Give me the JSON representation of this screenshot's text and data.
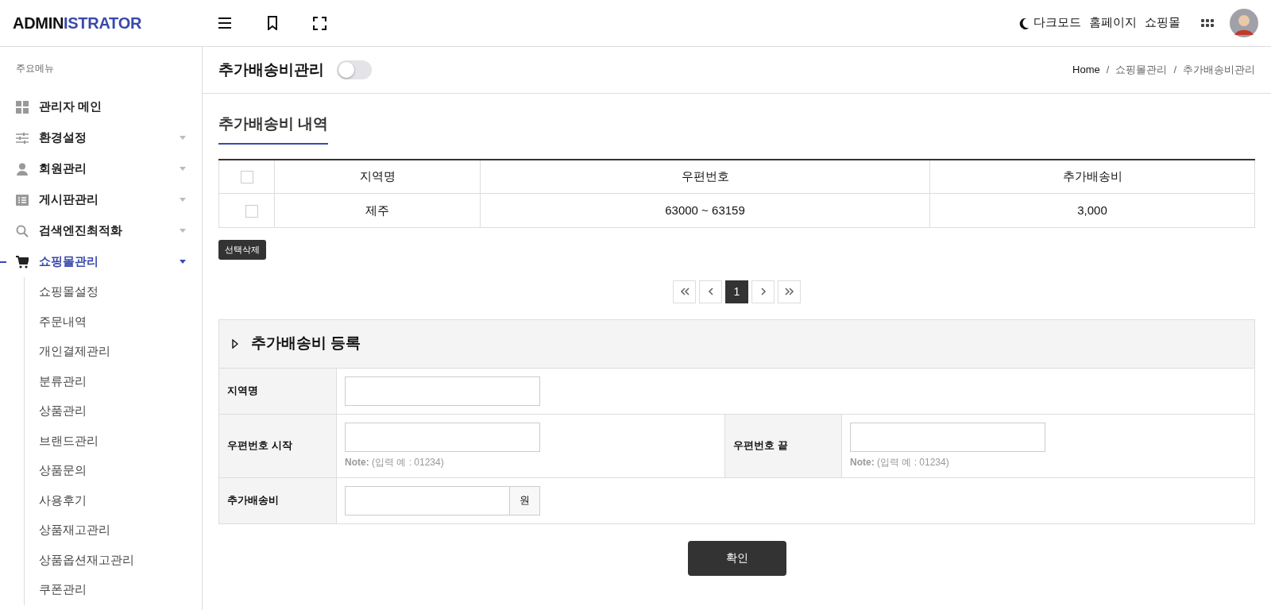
{
  "brand": {
    "part_1": "ADMIN",
    "part_2": "ISTRATOR"
  },
  "header_links": [
    {
      "label": "다크모드",
      "kind": "darkmode"
    },
    {
      "label": "홈페이지",
      "kind": "link"
    },
    {
      "label": "쇼핑몰",
      "kind": "link"
    }
  ],
  "sidebar": {
    "heading": "주요메뉴",
    "items": [
      {
        "label": "관리자 메인",
        "kind": "grid",
        "expandable": false,
        "selected": false
      },
      {
        "label": "환경설정",
        "kind": "sliders",
        "expandable": true,
        "selected": false
      },
      {
        "label": "회원관리",
        "kind": "person",
        "expandable": true,
        "selected": false
      },
      {
        "label": "게시판관리",
        "kind": "list",
        "expandable": true,
        "selected": false
      },
      {
        "label": "검색엔진최적화",
        "kind": "search",
        "expandable": true,
        "selected": false
      },
      {
        "label": "쇼핑몰관리",
        "kind": "cart",
        "expandable": true,
        "selected": true,
        "children": [
          {
            "label": "쇼핑몰설정"
          },
          {
            "label": "주문내역"
          },
          {
            "label": "개인결제관리"
          },
          {
            "label": "분류관리"
          },
          {
            "label": "상품관리"
          },
          {
            "label": "브랜드관리"
          },
          {
            "label": "상품문의"
          },
          {
            "label": "사용후기"
          },
          {
            "label": "상품재고관리"
          },
          {
            "label": "상품옵션재고관리"
          },
          {
            "label": "쿠폰관리"
          }
        ]
      }
    ]
  },
  "page": {
    "title": "추가배송비관리",
    "toggle": {
      "on": false
    },
    "breadcrumb": [
      {
        "label": "Home"
      },
      {
        "separator": "/",
        "label": "쇼핑몰관리"
      },
      {
        "separator": "/",
        "label": "추가배송비관리"
      }
    ]
  },
  "list_section": {
    "title": "추가배송비 내역",
    "table": {
      "select_all": {
        "checked": false
      },
      "columns": [
        "지역명",
        "우편번호",
        "추가배송비"
      ],
      "rows": [
        {
          "checked": false,
          "cells": [
            "제주",
            "63000 ~ 63159",
            "3,000"
          ]
        }
      ]
    },
    "delete_button": "선택삭제",
    "pagination": [
      {
        "kind": "first",
        "selected": false
      },
      {
        "kind": "prev",
        "selected": false
      },
      {
        "label": "1",
        "kind": "page",
        "selected": true
      },
      {
        "kind": "next",
        "selected": false
      },
      {
        "kind": "last",
        "selected": false
      }
    ]
  },
  "form": {
    "title": "추가배송비 등록",
    "rows": [
      {
        "fields": [
          {
            "label": "지역명"
          }
        ]
      },
      {
        "fields": [
          {
            "label": "우편번호 시작",
            "note_label": "Note:",
            "note": "(입력 예 : 01234)"
          },
          {
            "label": "우편번호 끝",
            "note_label": "Note:",
            "note": "(입력 예 : 01234)"
          }
        ]
      },
      {
        "fields": [
          {
            "label": "추가배송비",
            "suffix": "원"
          }
        ]
      }
    ]
  },
  "submit": "확인"
}
